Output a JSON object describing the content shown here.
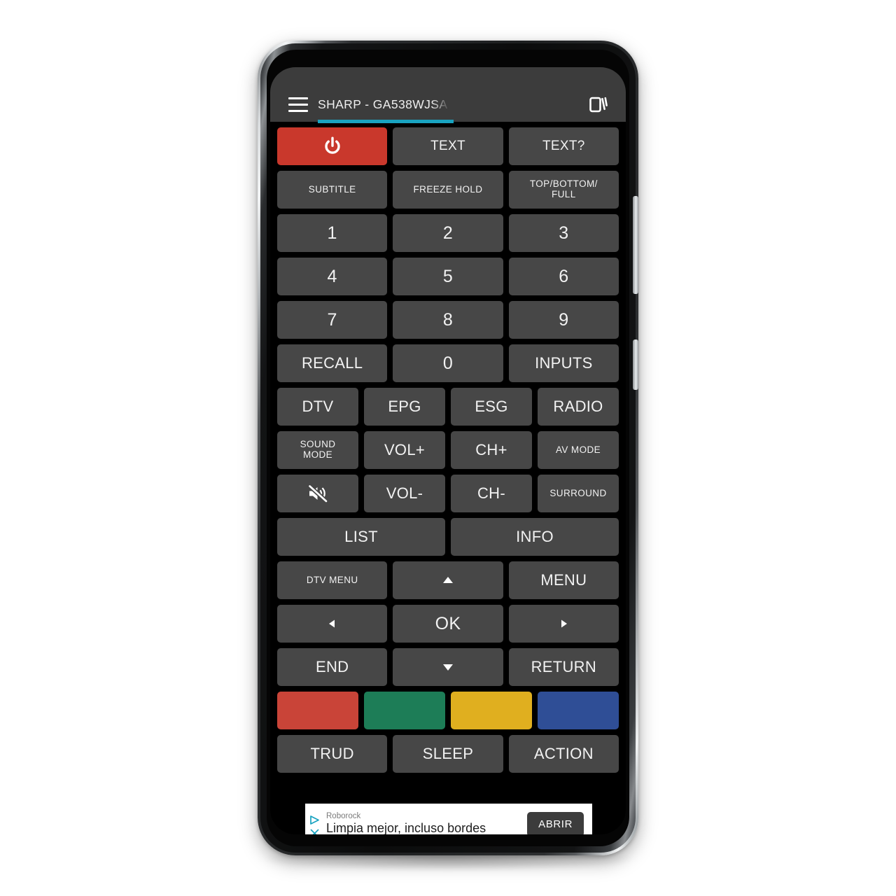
{
  "appbar": {
    "menu_icon": "hamburger-menu-icon",
    "title": "SHARP - GA538WJSA",
    "right_icon": "cards-stack-icon"
  },
  "remote": {
    "rows": [
      {
        "cols": 3,
        "buttons": [
          {
            "label": "",
            "icon": "power-icon",
            "style": "power"
          },
          {
            "label": "TEXT",
            "style": "normal"
          },
          {
            "label": "TEXT?",
            "style": "normal"
          }
        ]
      },
      {
        "cols": 3,
        "buttons": [
          {
            "label": "SUBTITLE",
            "style": "small"
          },
          {
            "label": "FREEZE HOLD",
            "style": "small"
          },
          {
            "label": "TOP/BOTTOM/ FULL",
            "style": "small"
          }
        ]
      },
      {
        "cols": 3,
        "buttons": [
          {
            "label": "1",
            "style": "num"
          },
          {
            "label": "2",
            "style": "num"
          },
          {
            "label": "3",
            "style": "num"
          }
        ]
      },
      {
        "cols": 3,
        "buttons": [
          {
            "label": "4",
            "style": "num"
          },
          {
            "label": "5",
            "style": "num"
          },
          {
            "label": "6",
            "style": "num"
          }
        ]
      },
      {
        "cols": 3,
        "buttons": [
          {
            "label": "7",
            "style": "num"
          },
          {
            "label": "8",
            "style": "num"
          },
          {
            "label": "9",
            "style": "num"
          }
        ]
      },
      {
        "cols": 3,
        "buttons": [
          {
            "label": "RECALL",
            "style": "big"
          },
          {
            "label": "0",
            "style": "num"
          },
          {
            "label": "INPUTS",
            "style": "big"
          }
        ]
      },
      {
        "cols": 4,
        "buttons": [
          {
            "label": "DTV",
            "style": "big"
          },
          {
            "label": "EPG",
            "style": "big"
          },
          {
            "label": "ESG",
            "style": "big"
          },
          {
            "label": "RADIO",
            "style": "big"
          }
        ]
      },
      {
        "cols": 4,
        "buttons": [
          {
            "label": "SOUND MODE",
            "style": "small"
          },
          {
            "label": "VOL+",
            "style": "big"
          },
          {
            "label": "CH+",
            "style": "big"
          },
          {
            "label": "AV MODE",
            "style": "small"
          }
        ]
      },
      {
        "cols": 4,
        "buttons": [
          {
            "label": "",
            "icon": "mute-icon",
            "style": "normal"
          },
          {
            "label": "VOL-",
            "style": "big"
          },
          {
            "label": "CH-",
            "style": "big"
          },
          {
            "label": "SURROUND",
            "style": "small"
          }
        ]
      },
      {
        "cols": 2,
        "buttons": [
          {
            "label": "LIST",
            "style": "big"
          },
          {
            "label": "INFO",
            "style": "big"
          }
        ]
      },
      {
        "cols": 3,
        "buttons": [
          {
            "label": "DTV MENU",
            "style": "small"
          },
          {
            "label": "",
            "icon": "arrow-up-icon",
            "style": "normal"
          },
          {
            "label": "MENU",
            "style": "big"
          }
        ]
      },
      {
        "cols": 3,
        "buttons": [
          {
            "label": "",
            "icon": "arrow-left-icon",
            "style": "normal"
          },
          {
            "label": "OK",
            "style": "num"
          },
          {
            "label": "",
            "icon": "arrow-right-icon",
            "style": "normal"
          }
        ]
      },
      {
        "cols": 3,
        "buttons": [
          {
            "label": "END",
            "style": "big"
          },
          {
            "label": "",
            "icon": "arrow-down-icon",
            "style": "normal"
          },
          {
            "label": "RETURN",
            "style": "big"
          }
        ]
      },
      {
        "cols": 4,
        "buttons": [
          {
            "label": "",
            "style": "c-red"
          },
          {
            "label": "",
            "style": "c-green"
          },
          {
            "label": "",
            "style": "c-yellow"
          },
          {
            "label": "",
            "style": "c-blue"
          }
        ]
      },
      {
        "cols": 3,
        "buttons": [
          {
            "label": "TRUD",
            "style": "big"
          },
          {
            "label": "SLEEP",
            "style": "big"
          },
          {
            "label": "ACTION",
            "style": "big"
          }
        ]
      }
    ]
  },
  "ad": {
    "adchoices_icon": "adchoices-triangle-icon",
    "close_icon": "close-x-icon",
    "brand": "Roborock",
    "headline": "Limpia mejor, incluso bordes",
    "cta_label": "ABRIR"
  },
  "colors": {
    "accent_tab": "#19a3c0",
    "power_red": "#c9382c",
    "button_gray": "#474747",
    "appbar_gray": "#3c3c3c",
    "screen_black": "#000000",
    "color_red": "#c94438",
    "color_green": "#1d7d57",
    "color_yellow": "#e0af1f",
    "color_blue": "#2f4e96"
  }
}
